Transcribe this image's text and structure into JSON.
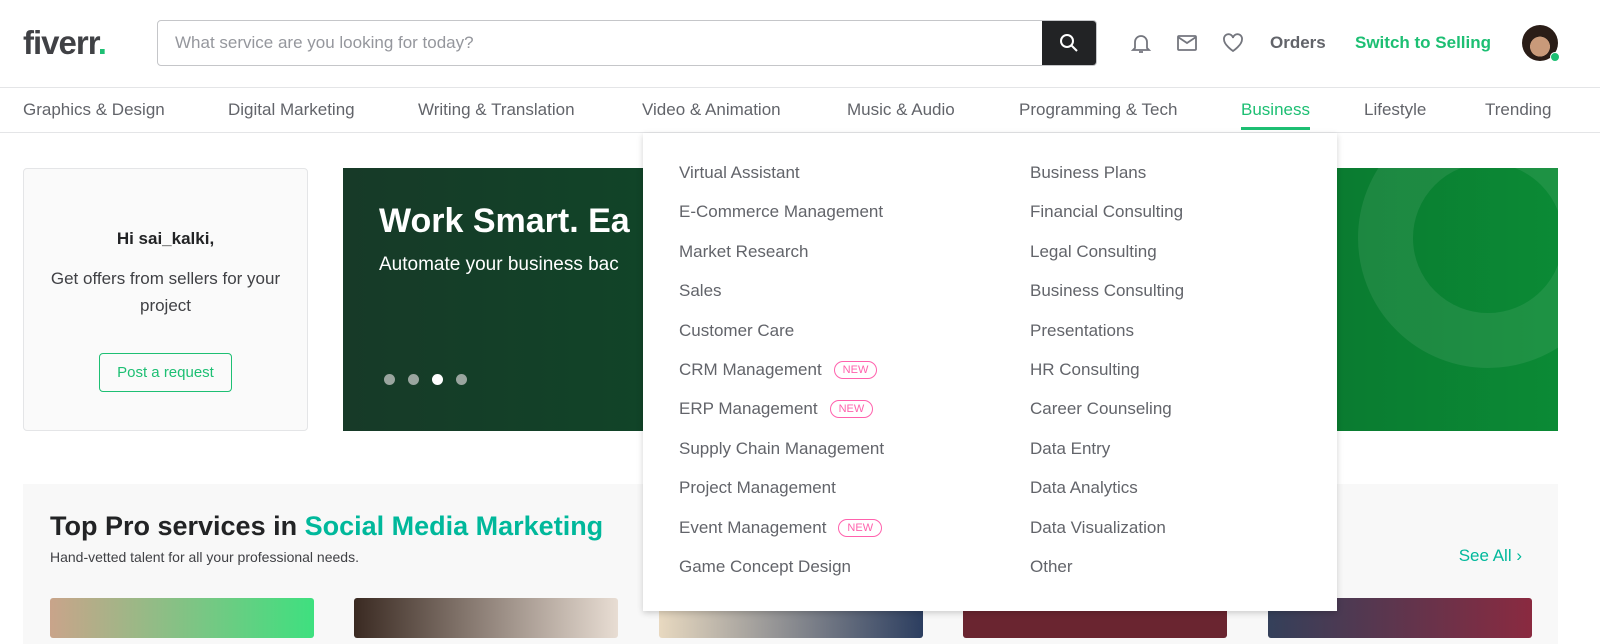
{
  "header": {
    "logo": "fiverr",
    "logo_dot": ".",
    "search_placeholder": "What service are you looking for today?",
    "orders": "Orders",
    "switch": "Switch to Selling"
  },
  "categories": [
    "Graphics & Design",
    "Digital Marketing",
    "Writing & Translation",
    "Video & Animation",
    "Music & Audio",
    "Programming & Tech",
    "Business",
    "Lifestyle",
    "Trending"
  ],
  "active_category": "Business",
  "dropdown": {
    "col1": [
      {
        "label": "Virtual Assistant"
      },
      {
        "label": "E-Commerce Management"
      },
      {
        "label": "Market Research"
      },
      {
        "label": "Sales"
      },
      {
        "label": "Customer Care"
      },
      {
        "label": "CRM Management",
        "badge": "NEW"
      },
      {
        "label": "ERP Management",
        "badge": "NEW"
      },
      {
        "label": "Supply Chain Management"
      },
      {
        "label": "Project Management"
      },
      {
        "label": "Event Management",
        "badge": "NEW"
      },
      {
        "label": "Game Concept Design"
      }
    ],
    "col2": [
      "Business Plans",
      "Financial Consulting",
      "Legal Consulting",
      "Business Consulting",
      "Presentations",
      "HR Consulting",
      "Career Counseling",
      "Data Entry",
      "Data Analytics",
      "Data Visualization",
      "Other"
    ]
  },
  "welcome": {
    "greeting": "Hi sai_kalki,",
    "text": "Get offers from sellers for your project",
    "button": "Post a request"
  },
  "banner": {
    "title": "Work Smart. Ea",
    "subtitle": "Automate your business bac",
    "active_slide": 3,
    "slides": 4
  },
  "pro": {
    "title": "Top Pro services in ",
    "highlight": "Social Media Marketing",
    "subtitle": "Hand-vetted talent for all your professional needs.",
    "see_all": "See All ›"
  },
  "colors": {
    "brand": "#1dbf73",
    "accent": "#00b89b",
    "badge": "#ff62ad"
  }
}
